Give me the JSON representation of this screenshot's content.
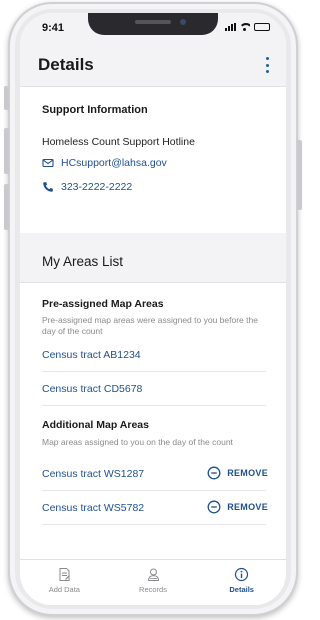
{
  "status_bar": {
    "time": "9:41"
  },
  "header": {
    "title": "Details"
  },
  "support": {
    "title": "Support Information",
    "hotline": "Homeless Count Support Hotline",
    "email": "HCsupport@lahsa.gov",
    "phone": "323-2222-2222"
  },
  "areas": {
    "title": "My Areas List",
    "preassigned": {
      "title": "Pre-assigned Map Areas",
      "description": "Pre-assigned map areas were assigned to you before the day of the count",
      "items": [
        {
          "label": "Census tract AB1234"
        },
        {
          "label": "Census tract CD5678"
        }
      ]
    },
    "additional": {
      "title": "Additional Map Areas",
      "description": "Map areas assigned to you on the day of the count",
      "remove_label": "REMOVE",
      "items": [
        {
          "label": "Census tract WS1287"
        },
        {
          "label": "Census tract WS5782"
        }
      ]
    }
  },
  "tabs": [
    {
      "label": "Add Data",
      "icon": "add-data-icon",
      "active": false
    },
    {
      "label": "Records",
      "icon": "records-icon",
      "active": false
    },
    {
      "label": "Details",
      "icon": "info-icon",
      "active": true
    }
  ],
  "colors": {
    "accent": "#1f4f8f",
    "muted": "#8a8a8e",
    "section_bg": "#f3f3f5"
  }
}
